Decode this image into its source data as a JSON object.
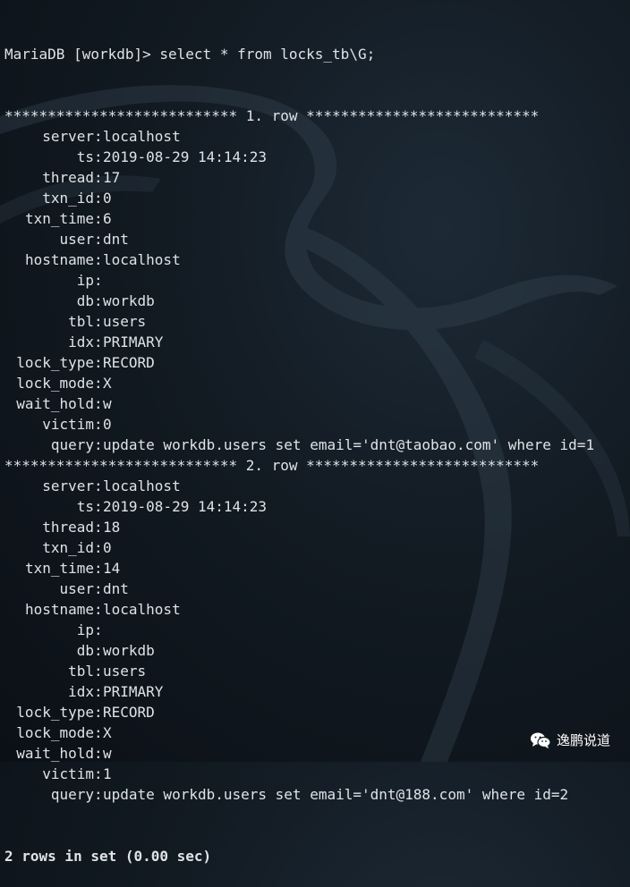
{
  "command_line": "MariaDB [workdb]> select * from locks_tb\\G;",
  "rows": [
    {
      "header": "*************************** 1. row ***************************",
      "fields": [
        {
          "key": "server",
          "value": "localhost"
        },
        {
          "key": "ts",
          "value": "2019-08-29 14:14:23"
        },
        {
          "key": "thread",
          "value": "17"
        },
        {
          "key": "txn_id",
          "value": "0"
        },
        {
          "key": "txn_time",
          "value": "6"
        },
        {
          "key": "user",
          "value": "dnt"
        },
        {
          "key": "hostname",
          "value": "localhost"
        },
        {
          "key": "ip",
          "value": ""
        },
        {
          "key": "db",
          "value": "workdb"
        },
        {
          "key": "tbl",
          "value": "users"
        },
        {
          "key": "idx",
          "value": "PRIMARY"
        },
        {
          "key": "lock_type",
          "value": "RECORD"
        },
        {
          "key": "lock_mode",
          "value": "X"
        },
        {
          "key": "wait_hold",
          "value": "w"
        },
        {
          "key": "victim",
          "value": "0"
        },
        {
          "key": "query",
          "value": "update workdb.users set email='dnt@taobao.com' where id=1"
        }
      ]
    },
    {
      "header": "*************************** 2. row ***************************",
      "fields": [
        {
          "key": "server",
          "value": "localhost"
        },
        {
          "key": "ts",
          "value": "2019-08-29 14:14:23"
        },
        {
          "key": "thread",
          "value": "18"
        },
        {
          "key": "txn_id",
          "value": "0"
        },
        {
          "key": "txn_time",
          "value": "14"
        },
        {
          "key": "user",
          "value": "dnt"
        },
        {
          "key": "hostname",
          "value": "localhost"
        },
        {
          "key": "ip",
          "value": ""
        },
        {
          "key": "db",
          "value": "workdb"
        },
        {
          "key": "tbl",
          "value": "users"
        },
        {
          "key": "idx",
          "value": "PRIMARY"
        },
        {
          "key": "lock_type",
          "value": "RECORD"
        },
        {
          "key": "lock_mode",
          "value": "X"
        },
        {
          "key": "wait_hold",
          "value": "w"
        },
        {
          "key": "victim",
          "value": "1"
        },
        {
          "key": "query",
          "value": "update workdb.users set email='dnt@188.com' where id=2"
        }
      ]
    }
  ],
  "summary": "2 rows in set (0.00 sec)",
  "watermark": {
    "text": "逸鹏说道",
    "icon": "wechat-icon"
  },
  "background": {
    "icon": "kali-dragon-icon",
    "color": "#121a22"
  }
}
